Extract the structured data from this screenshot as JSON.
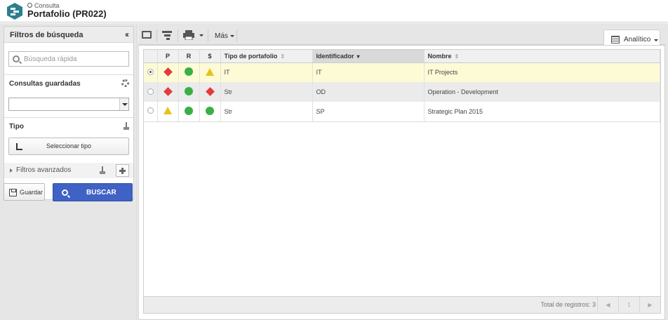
{
  "header": {
    "breadcrumb": "Consulta",
    "title": "Portafolio (PR022)"
  },
  "filters": {
    "panel_title": "Filtros de búsqueda",
    "quick_search_placeholder": "Búsqueda rápida",
    "saved_queries_label": "Consultas guardadas",
    "saved_query_value": "",
    "type_label": "Tipo",
    "select_type_button": "Seleccionar tipo",
    "advanced_filters_label": "Filtros avanzados",
    "save_button": "Guardar",
    "search_button": "BUSCAR"
  },
  "toolbar": {
    "more_label": "Más",
    "view_label": "Analítico"
  },
  "table": {
    "columns": [
      "P",
      "R",
      "$",
      "Tipo de portafolio",
      "Identificador",
      "Nombre"
    ],
    "rows": [
      {
        "p": "diamond",
        "r": "circle",
        "money": "triangle",
        "tipo": "IT",
        "id": "IT",
        "nombre": "IT Projects",
        "selected": true
      },
      {
        "p": "diamond",
        "r": "circle",
        "money": "diamond",
        "tipo": "Str",
        "id": "OD",
        "nombre": "Operation - Development",
        "selected": false
      },
      {
        "p": "triangle",
        "r": "circle",
        "money": "circle",
        "tipo": "Str",
        "id": "SP",
        "nombre": "Strategic Plan 2015",
        "selected": false
      }
    ],
    "total_label": "Total de registros: 3",
    "page": "1"
  },
  "colors": {
    "accent": "#3f62c4",
    "status_red": "#e23b3b",
    "status_green": "#3aaf48",
    "status_yellow": "#e4c31b",
    "selected_row": "#fdfbd6"
  }
}
